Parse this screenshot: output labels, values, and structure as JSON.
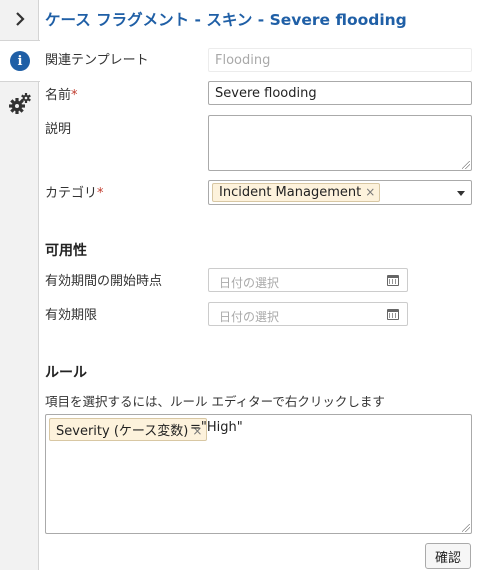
{
  "header": {
    "title": "ケース フラグメント - スキン - Severe flooding"
  },
  "rail": {
    "expand_icon": "chevron-right-icon",
    "info_icon": "info-icon",
    "settings_icon": "gears-icon",
    "info_glyph": "i"
  },
  "form": {
    "template_label": "関連テンプレート",
    "template_value": "Flooding",
    "name_label": "名前",
    "name_required": "*",
    "name_value": "Severe flooding",
    "description_label": "説明",
    "description_value": "",
    "category_label": "カテゴリ",
    "category_required": "*",
    "category_tag": "Incident Management",
    "tag_remove": "×"
  },
  "availability": {
    "heading": "可用性",
    "start_label": "有効期間の開始時点",
    "start_placeholder": "日付の選択",
    "end_label": "有効期限",
    "end_placeholder": "日付の選択"
  },
  "rules": {
    "heading": "ルール",
    "hint": "項目を選択するには、ルール エディターで右クリックします",
    "variable_tag": "Severity (ケース変数)",
    "tag_remove": "×",
    "expression": "=\"High\""
  },
  "footer": {
    "confirm_label": "確認"
  }
}
